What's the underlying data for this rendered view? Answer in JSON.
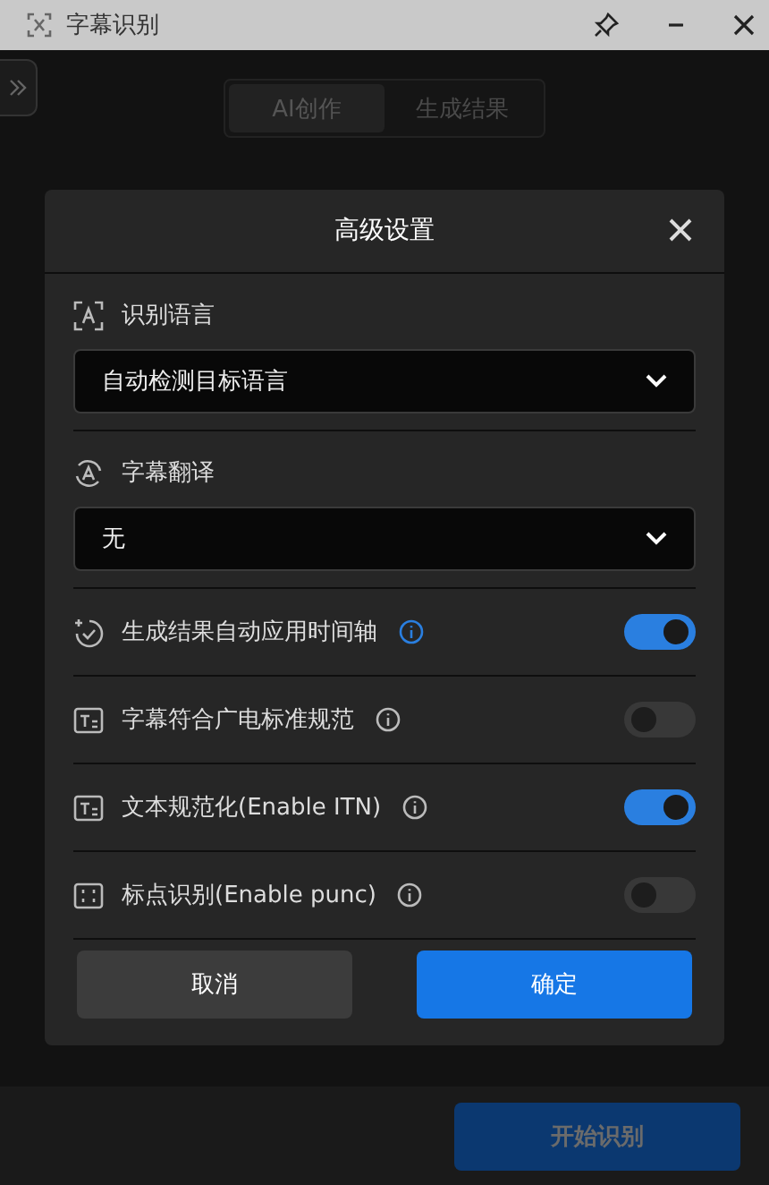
{
  "window": {
    "title": "字幕识别"
  },
  "tabs": [
    {
      "label": "AI创作",
      "selected": true
    },
    {
      "label": "生成结果",
      "selected": false
    }
  ],
  "dialog": {
    "title": "高级设置",
    "selects": [
      {
        "label": "识别语言",
        "value": "自动检测目标语言"
      },
      {
        "label": "字幕翻译",
        "value": "无"
      }
    ],
    "toggles": [
      {
        "label": "生成结果自动应用时间轴",
        "info_active": true,
        "on": true
      },
      {
        "label": "字幕符合广电标准规范",
        "info_active": false,
        "on": false
      },
      {
        "label": "文本规范化(Enable ITN)",
        "info_active": false,
        "on": true
      },
      {
        "label": "标点识别(Enable punc)",
        "info_active": false,
        "on": false
      }
    ],
    "cancel": "取消",
    "confirm": "确定"
  },
  "footer": {
    "start_button": "开始识别"
  }
}
